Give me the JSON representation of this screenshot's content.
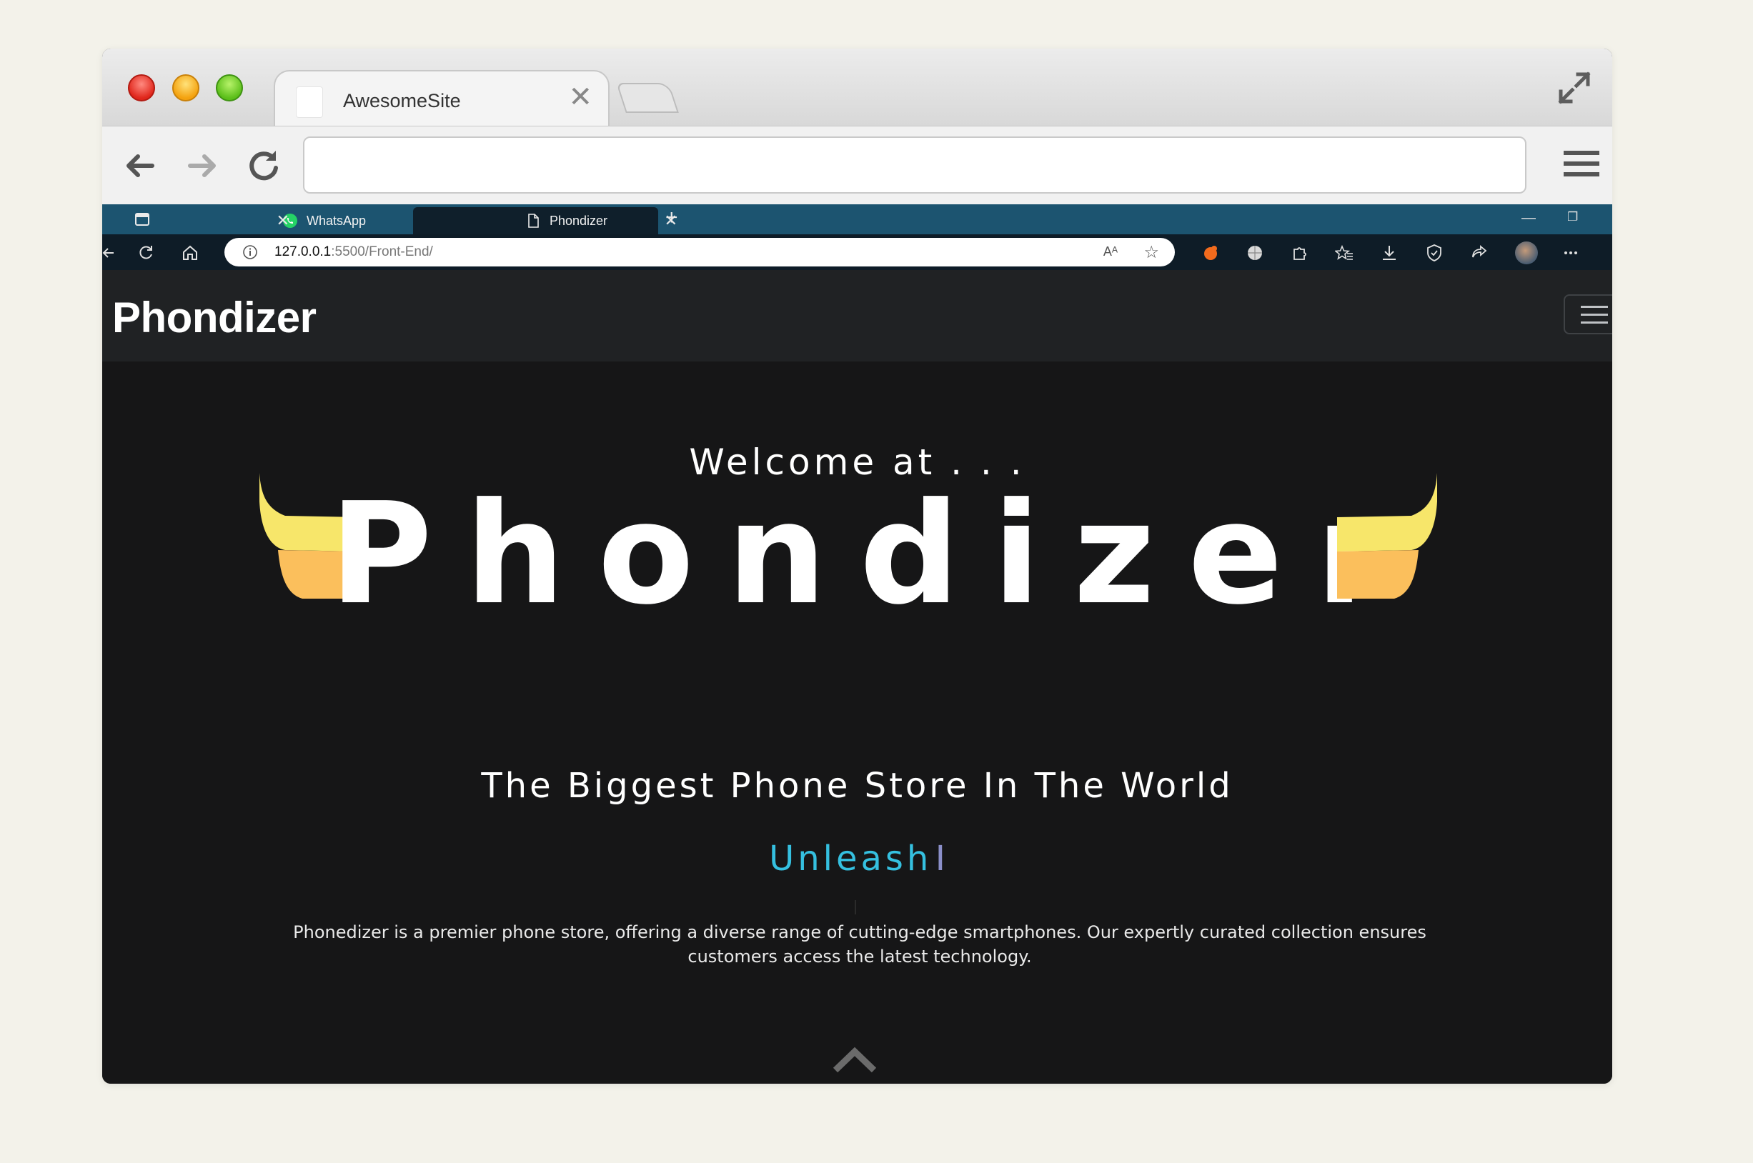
{
  "outer_browser": {
    "tab_title": "AwesomeSite",
    "tab_close": "✕"
  },
  "inner_browser": {
    "tabs": [
      {
        "label": "WhatsApp",
        "close": "✕",
        "icon": "whatsapp-icon"
      },
      {
        "label": "Phondizer",
        "close": "✕",
        "icon": "page-icon"
      }
    ],
    "new_tab": "+",
    "window_min": "—",
    "window_restore": "❐",
    "address": {
      "host": "127.0.0.1",
      "path": ":5500/Front-End/"
    },
    "read_aloud": "Aᴬ",
    "favorite": "☆"
  },
  "site": {
    "brand": "Phondizer",
    "welcome": "Welcome at . . .",
    "logo_text": "Phondizer",
    "tagline": "The Biggest Phone Store In The World",
    "typed_text": "Unleash",
    "typed_cursor": "I",
    "description": "Phonedizer is a premier phone store, offering a diverse range of cutting-edge smartphones. Our expertly curated collection ensures customers access the latest technology."
  },
  "colors": {
    "inner_tabbar": "#1c5470",
    "site_nav": "#202224",
    "hero_bg": "#161617",
    "wing_top": "#f7e66a",
    "wing_bottom": "#fbbf5c",
    "typed_accent": "#35c0e0"
  }
}
